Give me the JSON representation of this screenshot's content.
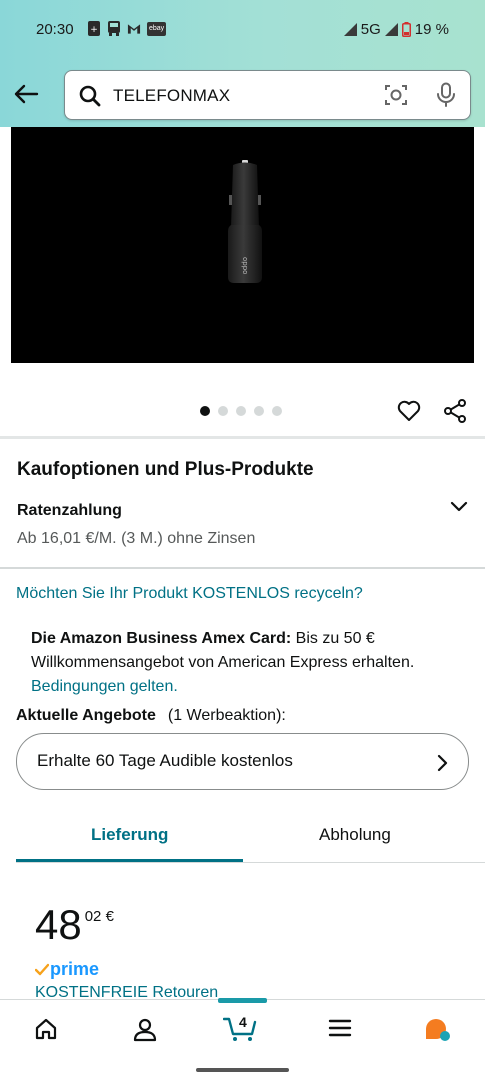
{
  "status_bar": {
    "time": "20:30",
    "network": "5G",
    "battery": "19 %",
    "notification_icons": [
      "calculator-icon",
      "bus-icon",
      "gmail-icon",
      "ebay-icon"
    ],
    "ebay_label": "ebay"
  },
  "search": {
    "value": "TELEFONMAX"
  },
  "gallery": {
    "image_count": 5,
    "active_index": 0
  },
  "purchase_options": {
    "title": "Kaufoptionen und Plus-Produkte",
    "installment_title": "Ratenzahlung",
    "installment_text": "Ab 16,01 €/M. (3 M.) ohne Zinsen"
  },
  "recycle_link": "Möchten Sie Ihr Produkt KOSTENLOS recyceln?",
  "amex": {
    "bold": "Die Amazon Business Amex Card:",
    "text": " Bis zu 50 € Willkommensangebot von American Express erhalten.",
    "link": "Bedingungen gelten."
  },
  "offers": {
    "label": "Aktuelle Angebote",
    "count_text": "(1 Werbeaktion):",
    "audible": "Erhalte 60 Tage Audible kostenlos"
  },
  "tabs": {
    "delivery": "Lieferung",
    "pickup": "Abholung"
  },
  "price": {
    "whole": "48",
    "fraction": "02 €",
    "prime_label": "prime",
    "returns": "KOSTENFREIE Retouren"
  },
  "bottom_nav": {
    "cart_count": "4"
  },
  "colors": {
    "header_gradient_start": "#8ad7d8",
    "header_gradient_end": "#a8e2cf",
    "link": "#007185",
    "prime": "#1a98ff",
    "rufus_orange": "#f47c20",
    "rufus_teal": "#1aa3b4"
  }
}
